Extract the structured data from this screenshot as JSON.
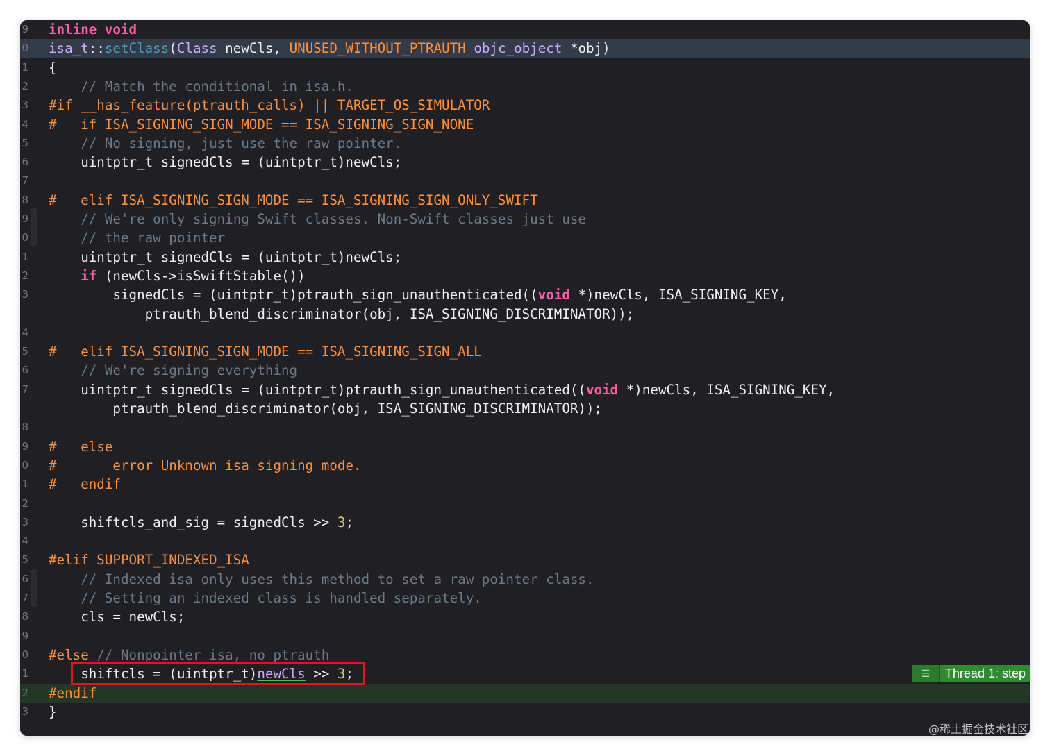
{
  "editor": {
    "lines": [
      {
        "num": "9",
        "segments": [
          {
            "c": "kw",
            "t": "inline"
          },
          {
            "c": "pl",
            "t": " "
          },
          {
            "c": "kw",
            "t": "void"
          }
        ]
      },
      {
        "num": "0",
        "segments": [
          {
            "c": "ty",
            "t": "isa_t"
          },
          {
            "c": "pl",
            "t": "::"
          },
          {
            "c": "mt",
            "t": "setClass"
          },
          {
            "c": "pl",
            "t": "("
          },
          {
            "c": "ty",
            "t": "Class"
          },
          {
            "c": "pl",
            "t": " newCls, "
          },
          {
            "c": "pp",
            "t": "UNUSED_WITHOUT_PTRAUTH"
          },
          {
            "c": "pl",
            "t": " "
          },
          {
            "c": "ty",
            "t": "objc_object"
          },
          {
            "c": "pl",
            "t": " *obj)"
          }
        ]
      },
      {
        "num": "1",
        "segments": [
          {
            "c": "pl",
            "t": "{"
          }
        ]
      },
      {
        "num": "2",
        "segments": [
          {
            "c": "cm",
            "t": "    // Match the conditional in isa.h."
          }
        ]
      },
      {
        "num": "3",
        "segments": [
          {
            "c": "pp",
            "t": "#if __has_feature(ptrauth_calls) || TARGET_OS_SIMULATOR"
          }
        ]
      },
      {
        "num": "4",
        "segments": [
          {
            "c": "pp",
            "t": "#   if ISA_SIGNING_SIGN_MODE == ISA_SIGNING_SIGN_NONE"
          }
        ]
      },
      {
        "num": "5",
        "segments": [
          {
            "c": "cm",
            "t": "    // No signing, just use the raw pointer."
          }
        ]
      },
      {
        "num": "6",
        "segments": [
          {
            "c": "pl",
            "t": "    uintptr_t signedCls = (uintptr_t)newCls;"
          }
        ]
      },
      {
        "num": "7",
        "segments": []
      },
      {
        "num": "8",
        "segments": [
          {
            "c": "pp",
            "t": "#   elif ISA_SIGNING_SIGN_MODE == ISA_SIGNING_SIGN_ONLY_SWIFT"
          }
        ]
      },
      {
        "num": "9",
        "segments": [
          {
            "c": "cm",
            "t": "    // We're only signing Swift classes. Non-Swift classes just use"
          }
        ]
      },
      {
        "num": "0",
        "segments": [
          {
            "c": "cm",
            "t": "    // the raw pointer"
          }
        ]
      },
      {
        "num": "1",
        "segments": [
          {
            "c": "pl",
            "t": "    uintptr_t signedCls = (uintptr_t)newCls;"
          }
        ]
      },
      {
        "num": "2",
        "segments": [
          {
            "c": "pl",
            "t": "    "
          },
          {
            "c": "kw",
            "t": "if"
          },
          {
            "c": "pl",
            "t": " (newCls->isSwiftStable())"
          }
        ]
      },
      {
        "num": "3",
        "segments": [
          {
            "c": "pl",
            "t": "        signedCls = (uintptr_t)ptrauth_sign_unauthenticated(("
          },
          {
            "c": "kw",
            "t": "void"
          },
          {
            "c": "pl",
            "t": " *)newCls, ISA_SIGNING_KEY,"
          }
        ]
      },
      {
        "num": "",
        "segments": [
          {
            "c": "pl",
            "t": "            ptrauth_blend_discriminator(obj, ISA_SIGNING_DISCRIMINATOR));"
          }
        ]
      },
      {
        "num": "4",
        "segments": []
      },
      {
        "num": "5",
        "segments": [
          {
            "c": "pp",
            "t": "#   elif ISA_SIGNING_SIGN_MODE == ISA_SIGNING_SIGN_ALL"
          }
        ]
      },
      {
        "num": "6",
        "segments": [
          {
            "c": "cm",
            "t": "    // We're signing everything"
          }
        ]
      },
      {
        "num": "7",
        "segments": [
          {
            "c": "pl",
            "t": "    uintptr_t signedCls = (uintptr_t)ptrauth_sign_unauthenticated(("
          },
          {
            "c": "kw",
            "t": "void"
          },
          {
            "c": "pl",
            "t": " *)newCls, ISA_SIGNING_KEY,"
          }
        ]
      },
      {
        "num": "",
        "segments": [
          {
            "c": "pl",
            "t": "        ptrauth_blend_discriminator(obj, ISA_SIGNING_DISCRIMINATOR));"
          }
        ]
      },
      {
        "num": "8",
        "segments": []
      },
      {
        "num": "9",
        "segments": [
          {
            "c": "pp",
            "t": "#   else"
          }
        ]
      },
      {
        "num": "0",
        "segments": [
          {
            "c": "pp",
            "t": "#       error Unknown isa signing mode."
          }
        ]
      },
      {
        "num": "1",
        "segments": [
          {
            "c": "pp",
            "t": "#   endif"
          }
        ]
      },
      {
        "num": "2",
        "segments": []
      },
      {
        "num": "3",
        "segments": [
          {
            "c": "pl",
            "t": "    shiftcls_and_sig = signedCls >> "
          },
          {
            "c": "num",
            "t": "3"
          },
          {
            "c": "pl",
            "t": ";"
          }
        ]
      },
      {
        "num": "4",
        "segments": []
      },
      {
        "num": "5",
        "segments": [
          {
            "c": "pp",
            "t": "#elif SUPPORT_INDEXED_ISA"
          }
        ]
      },
      {
        "num": "6",
        "segments": [
          {
            "c": "cm",
            "t": "    // Indexed isa only uses this method to set a raw pointer class."
          }
        ]
      },
      {
        "num": "7",
        "segments": [
          {
            "c": "cm",
            "t": "    // Setting an indexed class is handled separately."
          }
        ]
      },
      {
        "num": "8",
        "segments": [
          {
            "c": "pl",
            "t": "    cls = newCls;"
          }
        ]
      },
      {
        "num": "9",
        "segments": []
      },
      {
        "num": "0",
        "segments": [
          {
            "c": "pp",
            "t": "#else"
          },
          {
            "c": "cm",
            "t": " // Nonpointer isa, no ptrauth"
          }
        ]
      },
      {
        "num": "1",
        "segments": [
          {
            "c": "pl",
            "t": "    shiftcls = (uintptr_t)"
          },
          {
            "c": "dec",
            "t": "newCls"
          },
          {
            "c": "pl",
            "t": " >> "
          },
          {
            "c": "num",
            "t": "3"
          },
          {
            "c": "pl",
            "t": ";"
          }
        ]
      },
      {
        "num": "2",
        "segments": [
          {
            "c": "pp",
            "t": "#endif"
          }
        ]
      },
      {
        "num": "3",
        "segments": [
          {
            "c": "pl",
            "t": "}"
          }
        ]
      }
    ]
  },
  "debugger": {
    "thread_label": "Thread 1: step",
    "thread_icon": "lines-icon",
    "current_line_color": "#243626",
    "selected_line_color": "#333b49"
  },
  "watermark": "@稀土掘金技术社区",
  "colors": {
    "keyword": "#fc5fa3",
    "preprocessor": "#fd8f3f",
    "comment": "#6c7986",
    "type": "#d0a8ff",
    "method": "#41a1c0",
    "number": "#d9c97c",
    "annotation_box": "#e0161d"
  }
}
